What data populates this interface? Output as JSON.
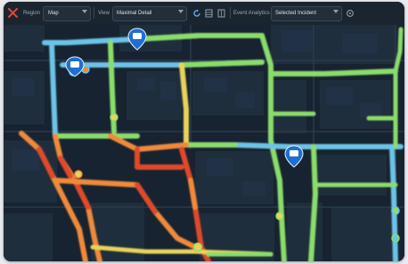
{
  "toolbar": {
    "region_label": "Region",
    "region_value": "Map",
    "view_label": "View",
    "view_value": "Maximal Detail",
    "event_label": "Event Analytics",
    "event_value": "Selected Incident"
  },
  "icons": [
    "close-icon",
    "refresh-icon",
    "layers-icon",
    "grid-icon",
    "settings-icon",
    "bus-icon",
    "info-icon"
  ],
  "colors": {
    "background": "#182430",
    "low": "#4aa8e6",
    "moderate": "#8bdc6a",
    "elevated": "#e8d45a",
    "high": "#f08a3a",
    "severe": "#e0482a",
    "marker": "#1f6fd0"
  }
}
